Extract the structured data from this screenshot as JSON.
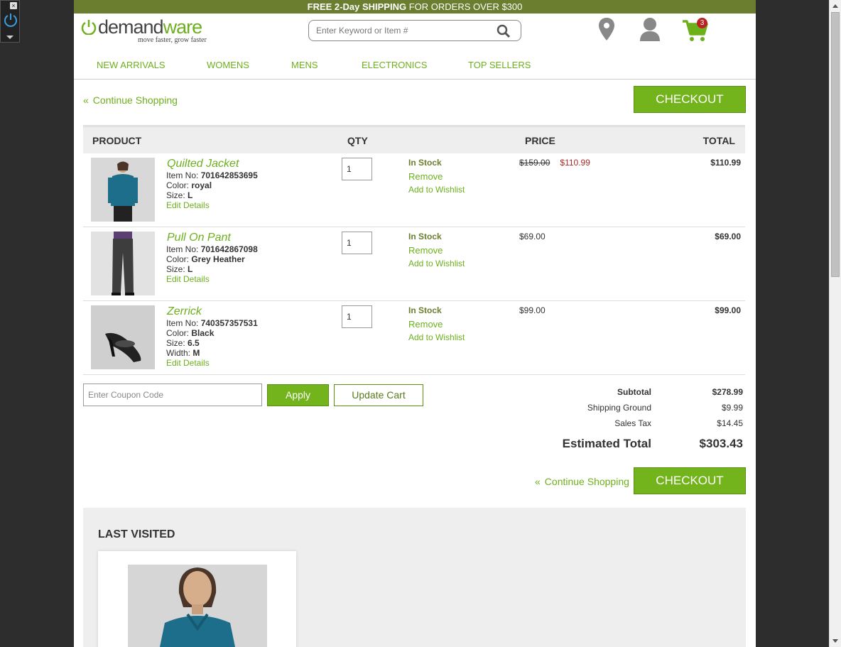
{
  "promo": {
    "free": "FREE",
    "days": "2-Day",
    "shipping": "SHIPPING",
    "rest": "FOR ORDERS OVER $300"
  },
  "brand": {
    "name_a": "demand",
    "name_b": "ware",
    "tagline": "move faster, grow faster"
  },
  "search": {
    "placeholder": "Enter Keyword or Item #"
  },
  "cart": {
    "count": "3"
  },
  "nav": {
    "items": [
      "NEW ARRIVALS",
      "WOMENS",
      "MENS",
      "ELECTRONICS",
      "TOP SELLERS"
    ]
  },
  "actions": {
    "continue_label": "Continue Shopping",
    "checkout_label": "CHECKOUT"
  },
  "table": {
    "headers": {
      "product": "PRODUCT",
      "qty": "QTY",
      "price": "PRICE",
      "total": "TOTAL"
    },
    "rows": [
      {
        "name": "Quilted Jacket",
        "item_label": "Item No: ",
        "item_no": "701642853695",
        "color_label": "Color: ",
        "color": "royal",
        "size_label": "Size: ",
        "size": "L",
        "width_label": "",
        "width": "",
        "edit": "Edit Details",
        "qty": "1",
        "stock": "In Stock",
        "remove": "Remove",
        "wishlist": "Add to Wishlist",
        "old_price": "$159.00",
        "price": "$110.99",
        "total": "$110.99"
      },
      {
        "name": "Pull On Pant",
        "item_label": "Item No: ",
        "item_no": "701642867098",
        "color_label": "Color: ",
        "color": "Grey Heather",
        "size_label": "Size: ",
        "size": "L",
        "width_label": "",
        "width": "",
        "edit": "Edit Details",
        "qty": "1",
        "stock": "In Stock",
        "remove": "Remove",
        "wishlist": "Add to Wishlist",
        "old_price": "",
        "price": "$69.00",
        "total": "$69.00"
      },
      {
        "name": "Zerrick",
        "item_label": "Item No: ",
        "item_no": "740357357531",
        "color_label": "Color: ",
        "color": "Black",
        "size_label": "Size: ",
        "size": "6.5",
        "width_label": "Width: ",
        "width": "M",
        "edit": "Edit Details",
        "qty": "1",
        "stock": "In Stock",
        "remove": "Remove",
        "wishlist": "Add to Wishlist",
        "old_price": "",
        "price": "$99.00",
        "total": "$99.00"
      }
    ]
  },
  "coupon": {
    "placeholder": "Enter Coupon Code",
    "apply": "Apply",
    "update": "Update Cart"
  },
  "summary": {
    "subtotal_label": "Subtotal",
    "subtotal": "$278.99",
    "shipping_label": "Shipping Ground",
    "shipping": "$9.99",
    "tax_label": "Sales Tax",
    "tax": "$14.45",
    "estimated_label": "Estimated Total",
    "estimated": "$303.43"
  },
  "last_visited": {
    "title": "LAST VISITED"
  },
  "colors": {
    "accent": "#73b41c",
    "promo_bar": "#6b7d2e",
    "sale": "#a42b2b"
  }
}
